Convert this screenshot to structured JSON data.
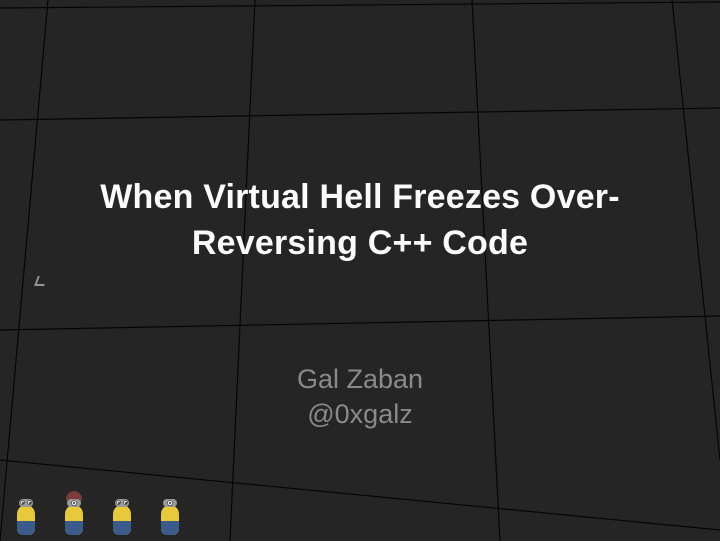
{
  "slide": {
    "title_line1": "When Virtual Hell Freezes Over-",
    "title_line2": "Reversing C++ Code",
    "author_name": "Gal Zaban",
    "author_handle": "@0xgalz"
  },
  "decor": {
    "character_count": 4,
    "character_icon": "minion-icon"
  }
}
